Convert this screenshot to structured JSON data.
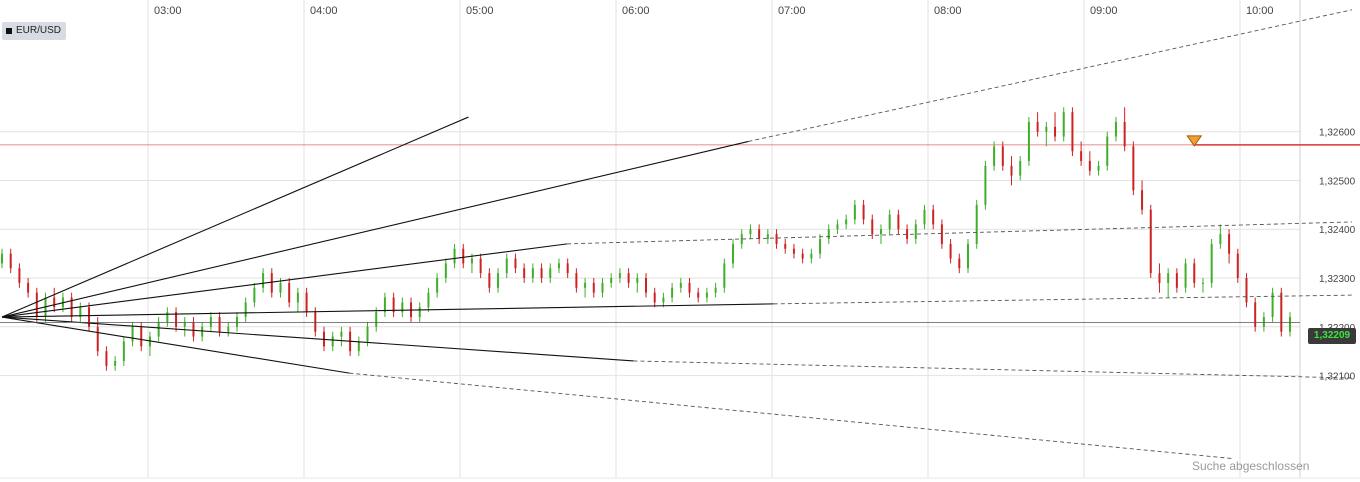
{
  "chart_data": {
    "type": "candlestick",
    "symbol": "EUR/USD",
    "x_ticks": [
      "03:00",
      "04:00",
      "05:00",
      "06:00",
      "07:00",
      "08:00",
      "09:00",
      "10:00"
    ],
    "y_ticks": [
      "1,32600",
      "1,32500",
      "1,32400",
      "1,32300",
      "1,32200",
      "1,32100"
    ],
    "last_price": "1,32209",
    "horizontal_level": 1.32573,
    "grid": true,
    "colors": {
      "up": "#3fae2a",
      "down": "#cc2222",
      "level": "#dd3333",
      "marker": "#f0a030"
    },
    "candles": [
      [
        1.3233,
        1.3236,
        1.3232,
        1.3235
      ],
      [
        1.3235,
        1.3236,
        1.3231,
        1.3232
      ],
      [
        1.3232,
        1.3233,
        1.3228,
        1.3229
      ],
      [
        1.3229,
        1.323,
        1.3226,
        1.3227
      ],
      [
        1.3227,
        1.3228,
        1.3221,
        1.3222
      ],
      [
        1.3222,
        1.3227,
        1.3221,
        1.3226
      ],
      [
        1.3226,
        1.3228,
        1.3223,
        1.3224
      ],
      [
        1.3224,
        1.3227,
        1.3223,
        1.3226
      ],
      [
        1.3226,
        1.3227,
        1.3221,
        1.3222
      ],
      [
        1.3222,
        1.3225,
        1.3221,
        1.3224
      ],
      [
        1.3224,
        1.3225,
        1.3219,
        1.322
      ],
      [
        1.322,
        1.3222,
        1.3214,
        1.3215
      ],
      [
        1.3215,
        1.3216,
        1.3211,
        1.3212
      ],
      [
        1.3212,
        1.3214,
        1.3211,
        1.3213
      ],
      [
        1.3213,
        1.3218,
        1.3212,
        1.3217
      ],
      [
        1.3217,
        1.3221,
        1.3216,
        1.322
      ],
      [
        1.322,
        1.3221,
        1.3215,
        1.3216
      ],
      [
        1.3216,
        1.3219,
        1.3214,
        1.3218
      ],
      [
        1.3218,
        1.3222,
        1.3217,
        1.3221
      ],
      [
        1.3221,
        1.3224,
        1.322,
        1.3223
      ],
      [
        1.3223,
        1.3224,
        1.3219,
        1.322
      ],
      [
        1.322,
        1.3222,
        1.3218,
        1.3221
      ],
      [
        1.3221,
        1.3222,
        1.3217,
        1.3218
      ],
      [
        1.3218,
        1.3221,
        1.3217,
        1.322
      ],
      [
        1.322,
        1.3223,
        1.3219,
        1.3222
      ],
      [
        1.3222,
        1.3223,
        1.3218,
        1.3219
      ],
      [
        1.3219,
        1.3221,
        1.3218,
        1.322
      ],
      [
        1.322,
        1.3223,
        1.3219,
        1.3222
      ],
      [
        1.3222,
        1.3226,
        1.3221,
        1.3225
      ],
      [
        1.3225,
        1.3229,
        1.3224,
        1.3228
      ],
      [
        1.3228,
        1.3232,
        1.3227,
        1.3231
      ],
      [
        1.3231,
        1.3232,
        1.3226,
        1.3227
      ],
      [
        1.3227,
        1.323,
        1.3226,
        1.3229
      ],
      [
        1.3229,
        1.323,
        1.3224,
        1.3225
      ],
      [
        1.3225,
        1.3228,
        1.3223,
        1.3227
      ],
      [
        1.3227,
        1.3228,
        1.3222,
        1.3223
      ],
      [
        1.3223,
        1.3224,
        1.3218,
        1.3219
      ],
      [
        1.3219,
        1.322,
        1.3215,
        1.3216
      ],
      [
        1.3216,
        1.3219,
        1.3215,
        1.3218
      ],
      [
        1.3218,
        1.322,
        1.3216,
        1.3219
      ],
      [
        1.3219,
        1.322,
        1.3214,
        1.3215
      ],
      [
        1.3215,
        1.3218,
        1.3214,
        1.3217
      ],
      [
        1.3217,
        1.3221,
        1.3216,
        1.322
      ],
      [
        1.322,
        1.3224,
        1.3219,
        1.3223
      ],
      [
        1.3223,
        1.3227,
        1.3222,
        1.3226
      ],
      [
        1.3226,
        1.3227,
        1.3222,
        1.3223
      ],
      [
        1.3223,
        1.3226,
        1.3222,
        1.3225
      ],
      [
        1.3225,
        1.3226,
        1.3221,
        1.3222
      ],
      [
        1.3222,
        1.3225,
        1.3221,
        1.3224
      ],
      [
        1.3224,
        1.3228,
        1.3223,
        1.3227
      ],
      [
        1.3227,
        1.3231,
        1.3226,
        1.323
      ],
      [
        1.323,
        1.3234,
        1.3229,
        1.3233
      ],
      [
        1.3233,
        1.3237,
        1.3232,
        1.3236
      ],
      [
        1.3236,
        1.3237,
        1.3232,
        1.3233
      ],
      [
        1.3233,
        1.3235,
        1.3231,
        1.3234
      ],
      [
        1.3234,
        1.3235,
        1.323,
        1.3231
      ],
      [
        1.3231,
        1.3232,
        1.3227,
        1.3228
      ],
      [
        1.3228,
        1.3232,
        1.3227,
        1.3231
      ],
      [
        1.3231,
        1.3235,
        1.323,
        1.3234
      ],
      [
        1.3234,
        1.3235,
        1.3231,
        1.3232
      ],
      [
        1.3232,
        1.3233,
        1.3229,
        1.323
      ],
      [
        1.323,
        1.3233,
        1.3229,
        1.3232
      ],
      [
        1.3232,
        1.3233,
        1.3229,
        1.323
      ],
      [
        1.323,
        1.3233,
        1.3229,
        1.3232
      ],
      [
        1.3232,
        1.3234,
        1.3231,
        1.3233
      ],
      [
        1.3233,
        1.3234,
        1.323,
        1.3231
      ],
      [
        1.3231,
        1.3232,
        1.3227,
        1.3228
      ],
      [
        1.3228,
        1.323,
        1.3226,
        1.3229
      ],
      [
        1.3229,
        1.323,
        1.3226,
        1.3227
      ],
      [
        1.3227,
        1.323,
        1.3226,
        1.3229
      ],
      [
        1.3229,
        1.3231,
        1.3228,
        1.323
      ],
      [
        1.323,
        1.3232,
        1.3229,
        1.3231
      ],
      [
        1.3231,
        1.3232,
        1.3228,
        1.3229
      ],
      [
        1.3229,
        1.3231,
        1.3227,
        1.323
      ],
      [
        1.323,
        1.3231,
        1.3226,
        1.3227
      ],
      [
        1.3227,
        1.3228,
        1.3224,
        1.3225
      ],
      [
        1.3225,
        1.3227,
        1.3224,
        1.3226
      ],
      [
        1.3226,
        1.3229,
        1.3225,
        1.3228
      ],
      [
        1.3228,
        1.323,
        1.3227,
        1.3229
      ],
      [
        1.3229,
        1.323,
        1.3226,
        1.3227
      ],
      [
        1.3227,
        1.3228,
        1.3225,
        1.3226
      ],
      [
        1.3226,
        1.3228,
        1.3225,
        1.3227
      ],
      [
        1.3227,
        1.3229,
        1.3226,
        1.3228
      ],
      [
        1.3228,
        1.3234,
        1.3227,
        1.3233
      ],
      [
        1.3233,
        1.3238,
        1.3232,
        1.3237
      ],
      [
        1.3237,
        1.324,
        1.3236,
        1.3239
      ],
      [
        1.3239,
        1.3241,
        1.3238,
        1.324
      ],
      [
        1.324,
        1.3241,
        1.3237,
        1.3238
      ],
      [
        1.3238,
        1.324,
        1.3237,
        1.3239
      ],
      [
        1.3239,
        1.324,
        1.3236,
        1.3237
      ],
      [
        1.3237,
        1.3238,
        1.3235,
        1.3236
      ],
      [
        1.3236,
        1.3237,
        1.3234,
        1.3235
      ],
      [
        1.3235,
        1.3236,
        1.3233,
        1.3234
      ],
      [
        1.3234,
        1.3236,
        1.3233,
        1.3235
      ],
      [
        1.3235,
        1.3239,
        1.3234,
        1.3238
      ],
      [
        1.3238,
        1.3241,
        1.3237,
        1.324
      ],
      [
        1.324,
        1.3242,
        1.3239,
        1.3241
      ],
      [
        1.3241,
        1.3243,
        1.324,
        1.3242
      ],
      [
        1.3242,
        1.3246,
        1.3241,
        1.3245
      ],
      [
        1.3245,
        1.3246,
        1.3241,
        1.3242
      ],
      [
        1.3242,
        1.3243,
        1.3238,
        1.3239
      ],
      [
        1.3239,
        1.3241,
        1.3237,
        1.324
      ],
      [
        1.324,
        1.3244,
        1.3239,
        1.3243
      ],
      [
        1.3243,
        1.3244,
        1.3239,
        1.324
      ],
      [
        1.324,
        1.3241,
        1.3237,
        1.3238
      ],
      [
        1.3238,
        1.3242,
        1.3237,
        1.3241
      ],
      [
        1.3241,
        1.3245,
        1.324,
        1.3244
      ],
      [
        1.3244,
        1.3245,
        1.324,
        1.3241
      ],
      [
        1.3241,
        1.3242,
        1.3236,
        1.3237
      ],
      [
        1.3237,
        1.3238,
        1.3233,
        1.3234
      ],
      [
        1.3234,
        1.3235,
        1.3231,
        1.3232
      ],
      [
        1.3232,
        1.3238,
        1.3231,
        1.3237
      ],
      [
        1.3237,
        1.3246,
        1.3236,
        1.3245
      ],
      [
        1.3245,
        1.3254,
        1.3244,
        1.3253
      ],
      [
        1.3253,
        1.3258,
        1.3252,
        1.3257
      ],
      [
        1.3257,
        1.3258,
        1.3252,
        1.3253
      ],
      [
        1.3253,
        1.3255,
        1.3249,
        1.3251
      ],
      [
        1.3251,
        1.3255,
        1.325,
        1.3254
      ],
      [
        1.3254,
        1.3263,
        1.3253,
        1.3262
      ],
      [
        1.3262,
        1.3264,
        1.3259,
        1.326
      ],
      [
        1.326,
        1.3262,
        1.3257,
        1.3261
      ],
      [
        1.3261,
        1.3264,
        1.3258,
        1.3259
      ],
      [
        1.3259,
        1.3265,
        1.3258,
        1.3264
      ],
      [
        1.3264,
        1.3265,
        1.3255,
        1.3256
      ],
      [
        1.3256,
        1.3258,
        1.3253,
        1.3254
      ],
      [
        1.3254,
        1.3256,
        1.3251,
        1.3252
      ],
      [
        1.3252,
        1.3254,
        1.3251,
        1.3253
      ],
      [
        1.3253,
        1.326,
        1.3252,
        1.3259
      ],
      [
        1.3259,
        1.3263,
        1.3258,
        1.3262
      ],
      [
        1.3262,
        1.3265,
        1.3256,
        1.3257
      ],
      [
        1.3257,
        1.3258,
        1.3247,
        1.3248
      ],
      [
        1.3248,
        1.325,
        1.3243,
        1.3244
      ],
      [
        1.3244,
        1.3245,
        1.323,
        1.3231
      ],
      [
        1.3231,
        1.3233,
        1.3227,
        1.3229
      ],
      [
        1.3229,
        1.3232,
        1.3226,
        1.3231
      ],
      [
        1.3231,
        1.3232,
        1.3227,
        1.3228
      ],
      [
        1.3228,
        1.3234,
        1.3227,
        1.3233
      ],
      [
        1.3233,
        1.3234,
        1.3228,
        1.3229
      ],
      [
        1.3229,
        1.323,
        1.3227,
        1.3229
      ],
      [
        1.3229,
        1.3238,
        1.3228,
        1.3237
      ],
      [
        1.3237,
        1.3241,
        1.3236,
        1.3239
      ],
      [
        1.3239,
        1.324,
        1.3233,
        1.3235
      ],
      [
        1.3235,
        1.3236,
        1.3229,
        1.323
      ],
      [
        1.323,
        1.3231,
        1.3224,
        1.3225
      ],
      [
        1.3225,
        1.3226,
        1.3219,
        1.322
      ],
      [
        1.322,
        1.3223,
        1.3219,
        1.3222
      ],
      [
        1.3222,
        1.3228,
        1.3221,
        1.3227
      ],
      [
        1.3227,
        1.3228,
        1.3218,
        1.3219
      ],
      [
        1.3219,
        1.3223,
        1.3218,
        1.3222
      ]
    ],
    "fans": [
      {
        "from": [
          0,
          1.3222
        ],
        "solid_to": [
          0.3455,
          1.3263
        ],
        "dash_to": null
      },
      {
        "from": [
          0,
          1.3222
        ],
        "solid_to": [
          0.5529,
          1.3258
        ],
        "dash_to": [
          1.0,
          1.3285
        ]
      },
      {
        "from": [
          0,
          1.3222
        ],
        "solid_to": [
          0.4186,
          1.3237
        ],
        "dash_to": [
          1.0,
          1.32415
        ]
      },
      {
        "from": [
          0,
          1.3222
        ],
        "solid_to": [
          0.5717,
          1.32247
        ],
        "dash_to": [
          1.0,
          1.32265
        ]
      },
      {
        "from": [
          0,
          1.3222
        ],
        "solid_to": [
          0.4678,
          1.3213
        ],
        "dash_to": [
          1.0,
          1.32095
        ]
      },
      {
        "from": [
          0,
          1.3222
        ],
        "solid_to": [
          0.2573,
          1.32105
        ],
        "dash_to": [
          0.9111,
          1.3193
        ]
      }
    ],
    "marker": {
      "index": 137,
      "price": 1.32573
    },
    "ylim": [
      1.3189,
      1.3287
    ]
  },
  "ui": {
    "status_text": "Suche abgeschlossen"
  }
}
